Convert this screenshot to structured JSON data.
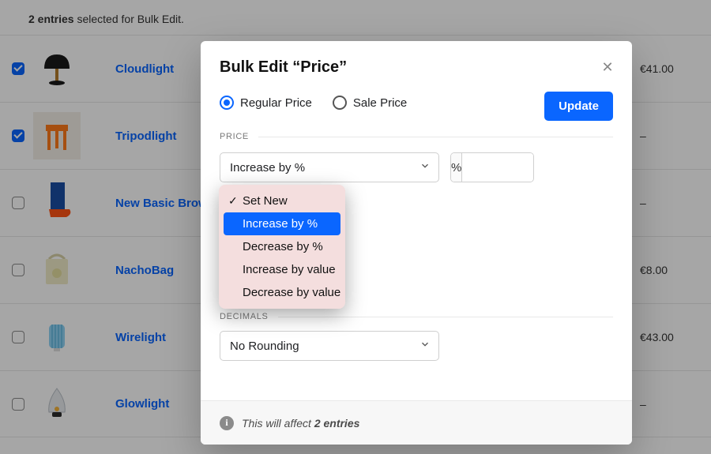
{
  "selection_bar": {
    "bold": "2 entries",
    "rest": " selected for Bulk Edit."
  },
  "products": [
    {
      "name": "Cloudlight",
      "checked": true,
      "price": "€41.00",
      "thumb": "lamp"
    },
    {
      "name": "Tripodlight",
      "checked": true,
      "price": "–",
      "thumb": "stool"
    },
    {
      "name": "New Basic Brown",
      "checked": false,
      "price": "–",
      "thumb": "shoes"
    },
    {
      "name": "NachoBag",
      "checked": false,
      "price": "€8.00",
      "thumb": "bag"
    },
    {
      "name": "Wirelight",
      "checked": false,
      "price": "€43.00",
      "thumb": "wire"
    },
    {
      "name": "Glowlight",
      "checked": false,
      "price": "–",
      "thumb": "glow"
    }
  ],
  "modal": {
    "title": "Bulk Edit “Price”",
    "radio": {
      "regular": "Regular Price",
      "sale": "Sale Price",
      "selected": "regular"
    },
    "update_label": "Update",
    "price_section": "PRICE",
    "operation_select": {
      "value": "Increase by %",
      "unit": "%",
      "input_value": ""
    },
    "dropdown_options": [
      {
        "label": "Set New",
        "checked": true,
        "highlight": false
      },
      {
        "label": "Increase by %",
        "checked": false,
        "highlight": true
      },
      {
        "label": "Decrease by %",
        "checked": false,
        "highlight": false
      },
      {
        "label": "Increase by value",
        "checked": false,
        "highlight": false
      },
      {
        "label": "Decrease by value",
        "checked": false,
        "highlight": false
      }
    ],
    "decimals_section": "DECIMALS",
    "rounding_select": {
      "value": "No Rounding"
    },
    "footer": {
      "prefix": "This will affect ",
      "bold": "2 entries"
    }
  }
}
